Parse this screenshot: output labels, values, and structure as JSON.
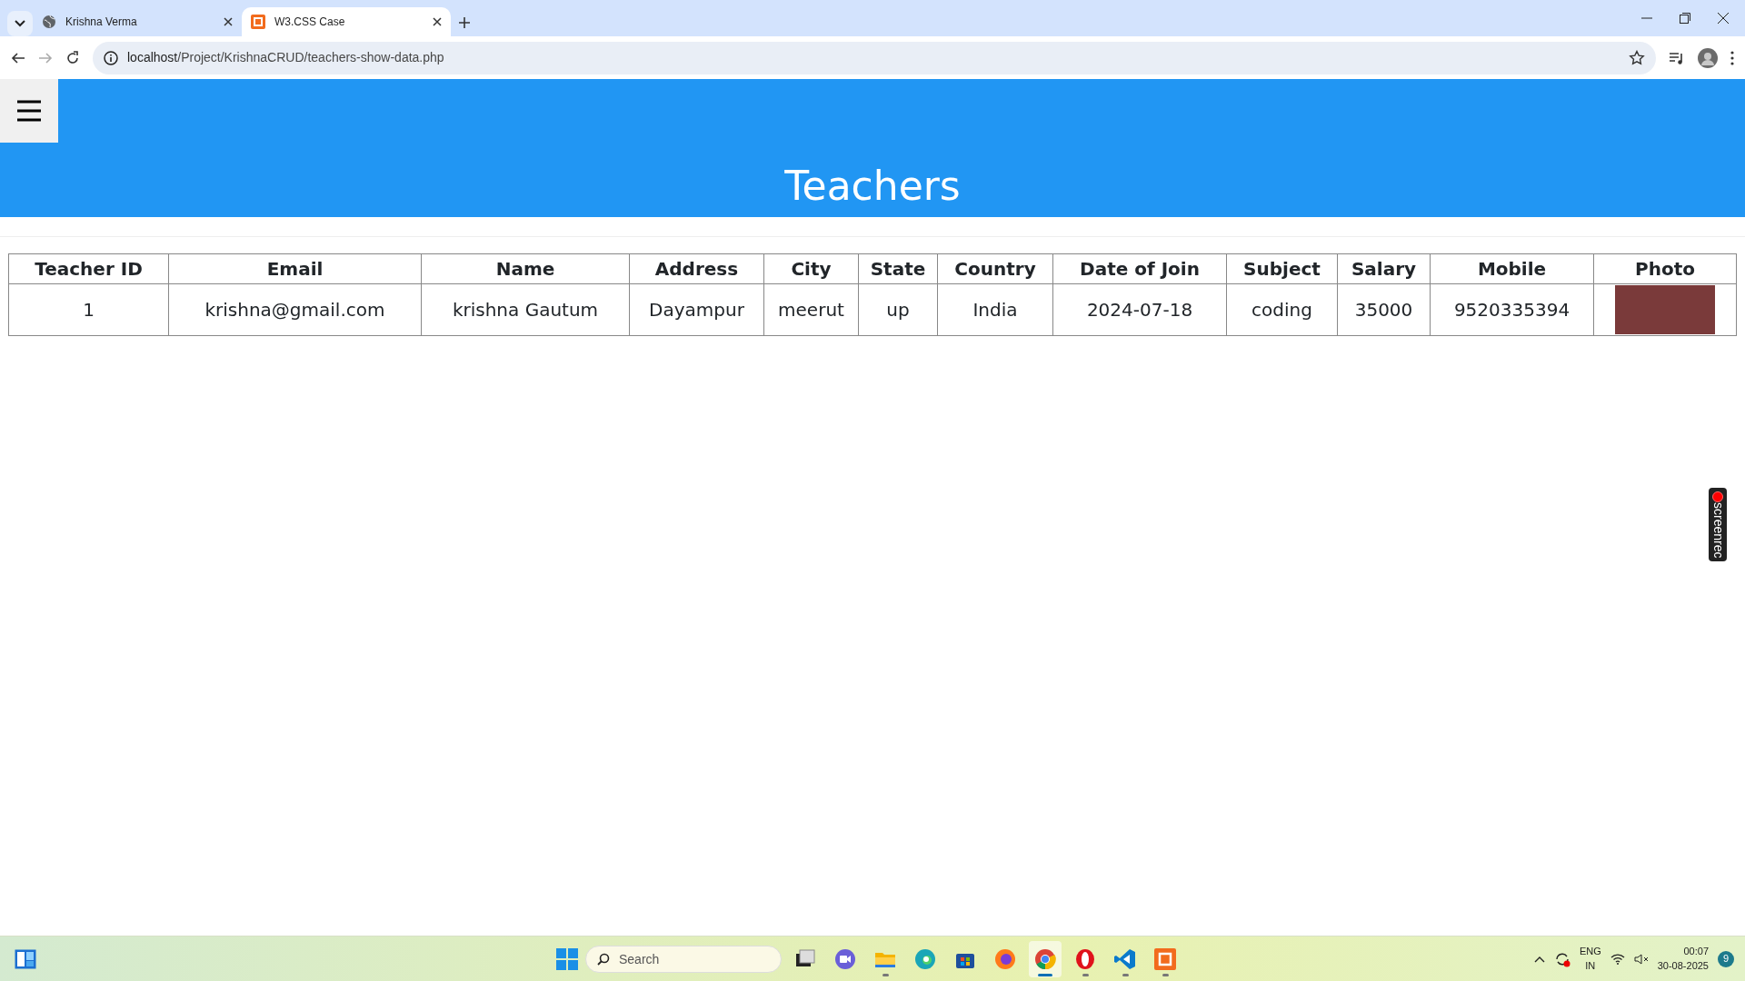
{
  "browser": {
    "tabs": [
      {
        "title": "Krishna Verma",
        "kind": "web",
        "selected": false
      },
      {
        "title": "W3.CSS Case",
        "kind": "app",
        "selected": true
      }
    ],
    "url_host": "localhost",
    "url_path": "/Project/KrishnaCRUD/teachers-show-data.php"
  },
  "page": {
    "title": "Teachers",
    "table": {
      "columns": [
        "Teacher ID",
        "Email",
        "Name",
        "Address",
        "City",
        "State",
        "Country",
        "Date of Join",
        "Subject",
        "Salary",
        "Mobile",
        "Photo"
      ],
      "rows": [
        [
          "1",
          "krishna@gmail.com",
          "krishna Gautum",
          "Dayampur",
          "meerut",
          "up",
          "India",
          "2024-07-18",
          "coding",
          "35000",
          "9520335394"
        ]
      ]
    }
  },
  "screenrec": {
    "label": "screenrec"
  },
  "taskbar": {
    "search_placeholder": "Search",
    "apps": [
      {
        "kind": "taskview",
        "running": false,
        "selected": false
      },
      {
        "kind": "meet",
        "running": false,
        "selected": false
      },
      {
        "kind": "folder",
        "running": true,
        "selected": false
      },
      {
        "kind": "edge",
        "running": false,
        "selected": false
      },
      {
        "kind": "store",
        "running": false,
        "selected": false
      },
      {
        "kind": "firefox",
        "running": false,
        "selected": false
      },
      {
        "kind": "chrome",
        "running": true,
        "selected": true
      },
      {
        "kind": "opera",
        "running": true,
        "selected": false
      },
      {
        "kind": "vscode",
        "running": true,
        "selected": false
      },
      {
        "kind": "xampp",
        "running": true,
        "selected": false
      }
    ],
    "language": "ENG",
    "region": "IN",
    "time": "00:07",
    "date": "30-08-2025",
    "notifications": "9"
  }
}
